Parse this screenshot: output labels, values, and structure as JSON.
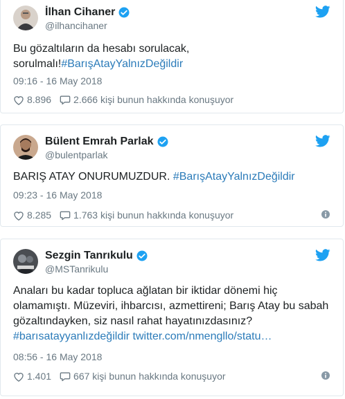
{
  "tweets": [
    {
      "name": "İlhan Cihaner",
      "handle": "@ilhancihaner",
      "text": "Bu gözaltıların da hesabı sorulacak, sorulmalı!",
      "hashtags": "#BarışAtayYalnızDeğildir",
      "time": "09:16 - 16 May 2018",
      "likes": "8.896",
      "replies": "2.666 kişi bunun hakkında konuşuyor"
    },
    {
      "name": "Bülent Emrah Parlak",
      "handle": "@bulentparlak",
      "text": "BARIŞ ATAY ONURUMUZDUR. ",
      "hashtags": "#BarışAtayYalnızDeğildir",
      "time": "09:23 - 16 May 2018",
      "likes": "8.285",
      "replies": "1.763 kişi bunun hakkında konuşuyor"
    },
    {
      "name": "Sezgin Tanrıkulu",
      "handle": "@MSTanrikulu",
      "text": "Anaları bu kadar topluca ağlatan bir iktidar dönemi hiç olamamıştı. Müzeviri, ihbarcısı, azmettireni; Barış Atay bu sabah gözaltındayken, siz nasıl rahat hayatınızdasınız?",
      "hashtags": "#barısatayyanlızdeğildir",
      "link": "twitter.com/nmengllo/statu…",
      "time": "08:56 - 16 May 2018",
      "likes": "1.401",
      "replies": "667 kişi bunun hakkında konuşuyor"
    }
  ],
  "colors": {
    "link": "#2b7bb9",
    "verified": "#1da1f2",
    "bird": "#1da1f2",
    "meta": "#697882",
    "border": "#e1e8ed"
  },
  "icons": [
    "verified-badge-icon",
    "twitter-bird-icon",
    "heart-icon",
    "reply-bubble-icon",
    "info-icon"
  ]
}
